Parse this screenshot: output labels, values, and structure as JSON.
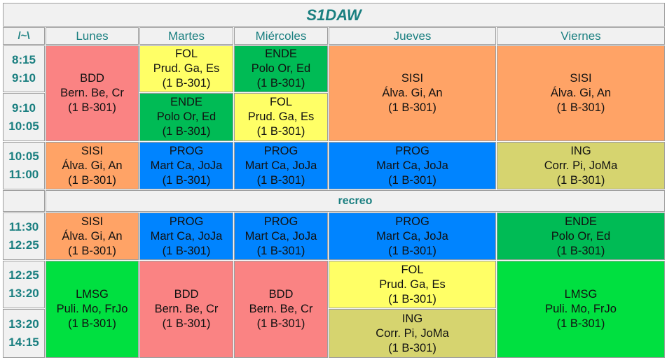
{
  "title": "S1DAW",
  "corner": "/~\\",
  "days": [
    "Lunes",
    "Martes",
    "Miércoles",
    "Jueves",
    "Viernes"
  ],
  "colors": {
    "BDD": "#fa8383",
    "FOL": "#ffff66",
    "ENDE": "#00bb55",
    "SISI": "#ffa366",
    "PROG": "#0084ff",
    "ING": "#d6d46f",
    "LMSG": "#00e040"
  },
  "times": [
    {
      "start": "8:15",
      "end": "9:10"
    },
    {
      "start": "9:10",
      "end": "10:05"
    },
    {
      "start": "10:05",
      "end": "11:00"
    },
    {
      "start": "11:30",
      "end": "12:25"
    },
    {
      "start": "12:25",
      "end": "13:20"
    },
    {
      "start": "13:20",
      "end": "14:15"
    }
  ],
  "recreo": "recreo",
  "sessions": [
    {
      "subject": "BDD",
      "teacher": "Bern. Be, Cr",
      "room": "(1 B-301)"
    },
    {
      "subject": "FOL",
      "teacher": "Prud. Ga, Es",
      "room": "(1 B-301)"
    },
    {
      "subject": "ENDE",
      "teacher": "Polo Or, Ed",
      "room": "(1 B-301)"
    },
    {
      "subject": "SISI",
      "teacher": "Álva. Gi, An",
      "room": "(1 B-301)"
    },
    {
      "subject": "SISI",
      "teacher": "Álva. Gi, An",
      "room": "(1 B-301)"
    },
    {
      "subject": "ENDE",
      "teacher": "Polo Or, Ed",
      "room": "(1 B-301)"
    },
    {
      "subject": "FOL",
      "teacher": "Prud. Ga, Es",
      "room": "(1 B-301)"
    },
    {
      "subject": "SISI",
      "teacher": "Álva. Gi, An",
      "room": "(1 B-301)"
    },
    {
      "subject": "PROG",
      "teacher": "Mart Ca, JoJa",
      "room": "(1 B-301)"
    },
    {
      "subject": "PROG",
      "teacher": "Mart Ca, JoJa",
      "room": "(1 B-301)"
    },
    {
      "subject": "PROG",
      "teacher": "Mart Ca, JoJa",
      "room": "(1 B-301)"
    },
    {
      "subject": "ING",
      "teacher": "Corr. Pi, JoMa",
      "room": "(1 B-301)"
    },
    {
      "subject": "SISI",
      "teacher": "Álva. Gi, An",
      "room": "(1 B-301)"
    },
    {
      "subject": "PROG",
      "teacher": "Mart Ca, JoJa",
      "room": "(1 B-301)"
    },
    {
      "subject": "PROG",
      "teacher": "Mart Ca, JoJa",
      "room": "(1 B-301)"
    },
    {
      "subject": "PROG",
      "teacher": "Mart Ca, JoJa",
      "room": "(1 B-301)"
    },
    {
      "subject": "ENDE",
      "teacher": "Polo Or, Ed",
      "room": "(1 B-301)"
    },
    {
      "subject": "LMSG",
      "teacher": "Puli. Mo, FrJo",
      "room": "(1 B-301)"
    },
    {
      "subject": "BDD",
      "teacher": "Bern. Be, Cr",
      "room": "(1 B-301)"
    },
    {
      "subject": "BDD",
      "teacher": "Bern. Be, Cr",
      "room": "(1 B-301)"
    },
    {
      "subject": "FOL",
      "teacher": "Prud. Ga, Es",
      "room": "(1 B-301)"
    },
    {
      "subject": "LMSG",
      "teacher": "Puli. Mo, FrJo",
      "room": "(1 B-301)"
    },
    {
      "subject": "ING",
      "teacher": "Corr. Pi, JoMa",
      "room": "(1 B-301)"
    }
  ]
}
